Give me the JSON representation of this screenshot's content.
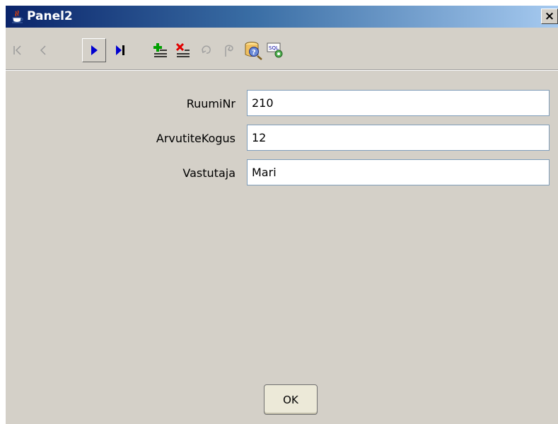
{
  "window": {
    "title": "Panel2",
    "close_label": "×"
  },
  "toolbar": {
    "buttons": [
      {
        "name": "first-record",
        "icon": "first-icon",
        "enabled": false
      },
      {
        "name": "previous-record",
        "icon": "previous-icon",
        "enabled": false
      },
      {
        "name": "next-record",
        "icon": "next-icon",
        "enabled": true
      },
      {
        "name": "last-record",
        "icon": "last-icon",
        "enabled": true
      },
      {
        "name": "insert-record",
        "icon": "insert-row-icon",
        "enabled": true
      },
      {
        "name": "delete-record",
        "icon": "delete-row-icon",
        "enabled": true
      },
      {
        "name": "undo",
        "icon": "undo-icon",
        "enabled": false
      },
      {
        "name": "redo",
        "icon": "redo-icon",
        "enabled": false
      },
      {
        "name": "query",
        "icon": "query-database-icon",
        "enabled": true
      },
      {
        "name": "sql",
        "icon": "sql-icon",
        "enabled": true
      }
    ],
    "sql_text": "SQL"
  },
  "form": {
    "fields": [
      {
        "label": "RuumiNr",
        "value": "210"
      },
      {
        "label": "ArvutiteKogus",
        "value": "12"
      },
      {
        "label": "Vastutaja",
        "value": "Mari"
      }
    ]
  },
  "ok_label": "OK",
  "colors": {
    "title_gradient_start": "#0a246a",
    "title_gradient_end": "#a6caf0",
    "window_bg": "#d4d0c8",
    "nav_blue": "#0000d0"
  }
}
